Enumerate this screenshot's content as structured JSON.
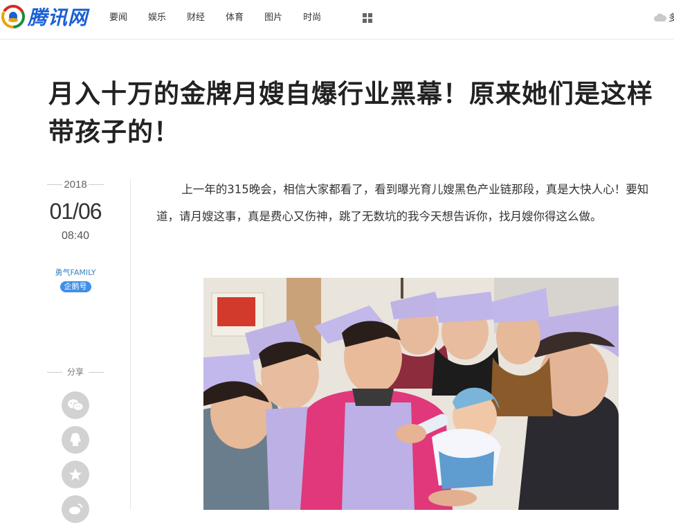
{
  "header": {
    "logo_text": "腾讯网",
    "nav": [
      "要闻",
      "娱乐",
      "财经",
      "体育",
      "图片",
      "时尚"
    ],
    "weather_text": "多"
  },
  "article": {
    "title": "月入十万的金牌月嫂自爆行业黑幕！原来她们是这样带孩子的！",
    "date": {
      "year": "2018",
      "day": "01/06",
      "time": "08:40"
    },
    "author": {
      "name": "勇气FAMILY",
      "badge": "企鹅号"
    },
    "paragraph": "上一年的315晚会，相信大家都看了，看到曝光育儿嫂黑色产业链那段，真是大快人心！要知道，请月嫂这事，真是费心又伤神，跳了无数坑的我今天想告诉你，找月嫂你得这么做。"
  },
  "share": {
    "label": "分享",
    "buttons": [
      "wechat-icon",
      "qq-icon",
      "qzone-star-icon",
      "weibo-icon"
    ]
  },
  "colors": {
    "brand_blue": "#1a5fd4",
    "badge_blue": "#3f8fe8",
    "author_blue": "#3b82c4",
    "share_gray": "#d2d2d2"
  }
}
